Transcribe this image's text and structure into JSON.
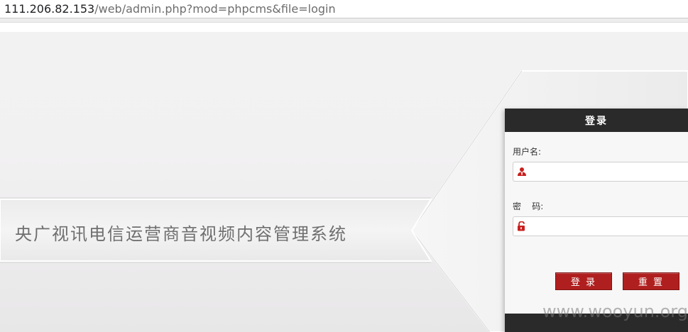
{
  "address_bar": {
    "host": "111.206.82.153",
    "path": "/web/admin.php?mod=phpcms&file=login"
  },
  "banner": {
    "title": "央广视讯电信运营商音视频内容管理系统"
  },
  "login": {
    "header": "登录",
    "username_label": "用户名:",
    "username_value": "",
    "password_label": "密    码:",
    "password_value": "",
    "submit_label": "登 录",
    "reset_label": "重 置",
    "icons": {
      "username": "user-icon",
      "password": "unlock-icon"
    }
  },
  "watermark": "www.wooyun.org",
  "colors": {
    "accent": "#b01f1f",
    "header_bg": "#2a2a2a",
    "title_text": "#6f6f6f"
  }
}
